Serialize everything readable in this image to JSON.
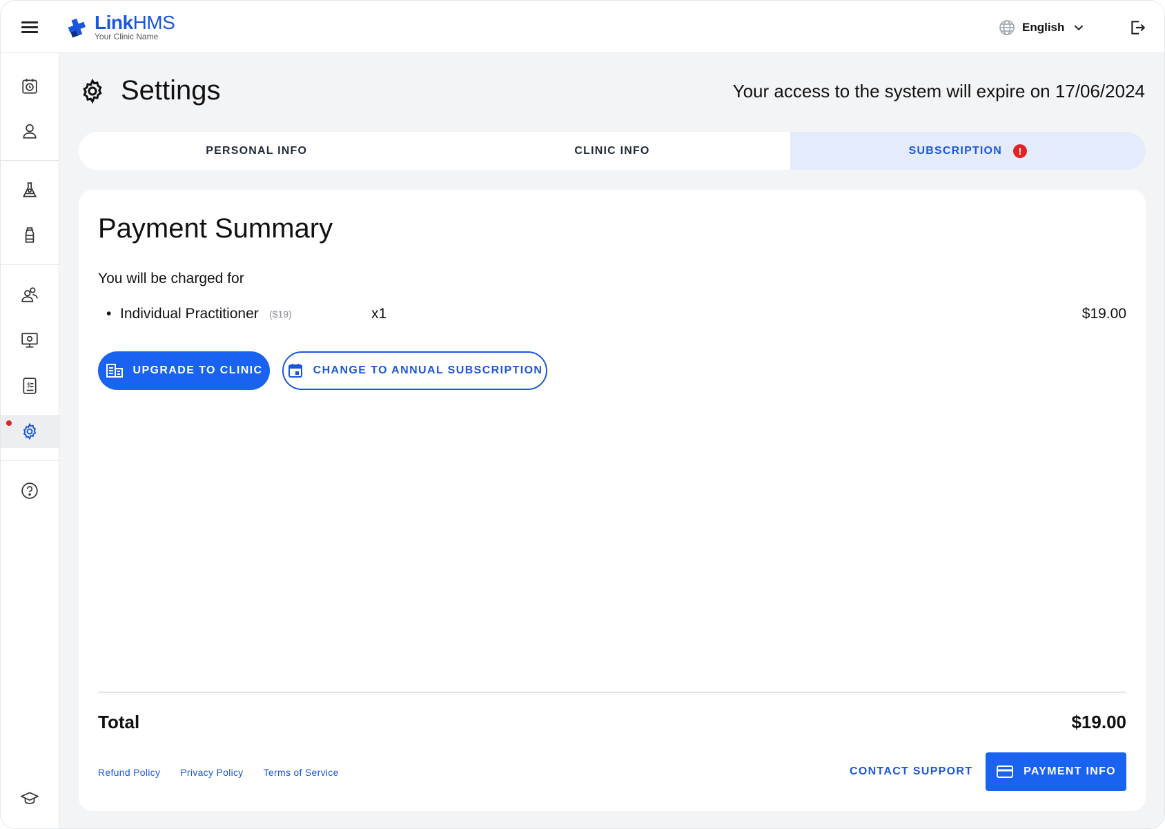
{
  "brand": {
    "name_part1": "Link",
    "name_part2": "HMS",
    "subtitle": "Your Clinic Name",
    "icon": "medical-cross-logo"
  },
  "topbar": {
    "menu_icon": "hamburger-menu-icon",
    "language": "English",
    "language_icon": "globe-icon",
    "logout_icon": "logout-icon"
  },
  "sidebar": {
    "items": [
      {
        "icon": "calendar-clock-icon",
        "active": false
      },
      {
        "icon": "user-icon",
        "active": false
      },
      {
        "icon": "lab-flask-icon",
        "active": false
      },
      {
        "icon": "medicine-bottle-icon",
        "active": false
      },
      {
        "icon": "users-group-icon",
        "active": false
      },
      {
        "icon": "monitor-settings-icon",
        "active": false
      },
      {
        "icon": "invoice-dollar-icon",
        "active": false
      },
      {
        "icon": "gear-icon",
        "active": true,
        "notification": true
      },
      {
        "icon": "help-circle-icon",
        "active": false
      },
      {
        "icon": "graduation-cap-icon",
        "active": false
      }
    ]
  },
  "header": {
    "title": "Settings",
    "title_icon": "gear-icon",
    "expiry_notice": "Your access to the system will expire on 17/06/2024"
  },
  "tabs": [
    {
      "label": "PERSONAL INFO",
      "selected": false
    },
    {
      "label": "CLINIC INFO",
      "selected": false
    },
    {
      "label": "SUBSCRIPTION",
      "selected": true,
      "alert": "!"
    }
  ],
  "summary": {
    "title": "Payment Summary",
    "charged_for": "You will be charged for",
    "items": [
      {
        "bullet": "•",
        "name": "Individual Practitioner",
        "unit_price": "($19)",
        "quantity": "x1",
        "amount": "$19.00"
      }
    ],
    "upgrade_button": "UPGRADE TO CLINIC",
    "annual_button": "CHANGE TO ANNUAL SUBSCRIPTION",
    "total_label": "Total",
    "total_value": "$19.00"
  },
  "footer": {
    "links": [
      "Refund Policy",
      "Privacy Policy",
      "Terms of Service"
    ],
    "contact_support": "CONTACT SUPPORT",
    "payment_info": "PAYMENT INFO"
  },
  "colors": {
    "accent": "#1a63f0",
    "accent_text": "#1a56db",
    "selected_tab_bg": "#e4ecfb",
    "alert": "#e02424",
    "background": "#f3f4f6"
  }
}
